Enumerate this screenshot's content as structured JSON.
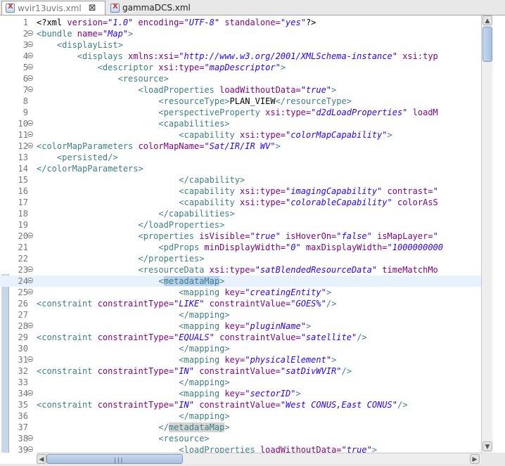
{
  "tabs": [
    {
      "title": "wvir13uvis.xml",
      "close": "⊠",
      "active": true
    },
    {
      "title": "gammaDCS.xml",
      "active": false
    }
  ],
  "lines": [
    {
      "n": "1",
      "fold": false,
      "segs": [
        [
          "t",
          "<?xml "
        ],
        [
          "a",
          "version="
        ],
        [
          "v",
          "\"1.0\""
        ],
        [
          "a",
          " encoding="
        ],
        [
          "v",
          "\"UTF-8\""
        ],
        [
          "a",
          " standalone="
        ],
        [
          "v",
          "\"yes\""
        ],
        [
          "t",
          "?>"
        ]
      ]
    },
    {
      "n": "2",
      "fold": true,
      "segs": [
        [
          "g",
          "<bundle "
        ],
        [
          "a",
          "name="
        ],
        [
          "v",
          "\"Map\""
        ],
        [
          "g",
          ">"
        ]
      ]
    },
    {
      "n": "3",
      "fold": true,
      "segs": [
        [
          "t",
          "    "
        ],
        [
          "g",
          "<displayList>"
        ]
      ]
    },
    {
      "n": "4",
      "fold": true,
      "segs": [
        [
          "t",
          "        "
        ],
        [
          "g",
          "<displays "
        ],
        [
          "a",
          "xmlns:xsi="
        ],
        [
          "v",
          "\"http://www.w3.org/2001/XMLSchema-instance\""
        ],
        [
          "a",
          " xsi:typ"
        ]
      ]
    },
    {
      "n": "5",
      "fold": true,
      "segs": [
        [
          "t",
          "            "
        ],
        [
          "g",
          "<descriptor "
        ],
        [
          "a",
          "xsi:type="
        ],
        [
          "v",
          "\"mapDescriptor\""
        ],
        [
          "g",
          ">"
        ]
      ]
    },
    {
      "n": "6",
      "fold": true,
      "segs": [
        [
          "t",
          "                "
        ],
        [
          "g",
          "<resource>"
        ]
      ]
    },
    {
      "n": "7",
      "fold": true,
      "segs": [
        [
          "t",
          "                    "
        ],
        [
          "g",
          "<loadProperties "
        ],
        [
          "a",
          "loadWithoutData="
        ],
        [
          "v",
          "\"true\""
        ],
        [
          "g",
          ">"
        ]
      ]
    },
    {
      "n": "8",
      "fold": false,
      "segs": [
        [
          "t",
          "                        "
        ],
        [
          "g",
          "<resourceType>"
        ],
        [
          "t",
          "PLAN_VIEW"
        ],
        [
          "g",
          "</resourceType>"
        ]
      ]
    },
    {
      "n": "9",
      "fold": false,
      "segs": [
        [
          "t",
          "                        "
        ],
        [
          "g",
          "<perspectiveProperty "
        ],
        [
          "a",
          "xsi:type="
        ],
        [
          "v",
          "\"d2dLoadProperties\""
        ],
        [
          "a",
          " loadM"
        ]
      ]
    },
    {
      "n": "10",
      "fold": true,
      "segs": [
        [
          "t",
          "                        "
        ],
        [
          "g",
          "<capabilities>"
        ]
      ]
    },
    {
      "n": "11",
      "fold": true,
      "segs": [
        [
          "t",
          "                            "
        ],
        [
          "g",
          "<capability "
        ],
        [
          "a",
          "xsi:type="
        ],
        [
          "v",
          "\"colorMapCapability\""
        ],
        [
          "g",
          ">"
        ]
      ]
    },
    {
      "n": "12",
      "fold": true,
      "segs": [
        [
          "g",
          "<colorMapParameters "
        ],
        [
          "a",
          "colorMapName="
        ],
        [
          "v",
          "\"Sat/IR/IR WV\""
        ],
        [
          "g",
          ">"
        ]
      ]
    },
    {
      "n": "13",
      "fold": false,
      "segs": [
        [
          "t",
          "    "
        ],
        [
          "g",
          "<persisted/>"
        ]
      ]
    },
    {
      "n": "14",
      "fold": false,
      "segs": [
        [
          "g",
          "</colorMapParameters>"
        ]
      ]
    },
    {
      "n": "15",
      "fold": false,
      "segs": [
        [
          "t",
          "                            "
        ],
        [
          "g",
          "</capability>"
        ]
      ]
    },
    {
      "n": "16",
      "fold": false,
      "segs": [
        [
          "t",
          "                            "
        ],
        [
          "g",
          "<capability "
        ],
        [
          "a",
          "xsi:type="
        ],
        [
          "v",
          "\"imagingCapability\""
        ],
        [
          "a",
          " contrast="
        ],
        [
          "v",
          "\""
        ]
      ]
    },
    {
      "n": "17",
      "fold": false,
      "segs": [
        [
          "t",
          "                            "
        ],
        [
          "g",
          "<capability "
        ],
        [
          "a",
          "xsi:type="
        ],
        [
          "v",
          "\"colorableCapability\""
        ],
        [
          "a",
          " colorAsS"
        ]
      ]
    },
    {
      "n": "18",
      "fold": false,
      "segs": [
        [
          "t",
          "                        "
        ],
        [
          "g",
          "</capabilities>"
        ]
      ]
    },
    {
      "n": "19",
      "fold": false,
      "segs": [
        [
          "t",
          "                    "
        ],
        [
          "g",
          "</loadProperties>"
        ]
      ]
    },
    {
      "n": "20",
      "fold": true,
      "segs": [
        [
          "t",
          "                    "
        ],
        [
          "g",
          "<properties "
        ],
        [
          "a",
          "isVisible="
        ],
        [
          "v",
          "\"true\""
        ],
        [
          "a",
          " isHoverOn="
        ],
        [
          "v",
          "\"false\""
        ],
        [
          "a",
          " isMapLayer="
        ],
        [
          "v",
          "\""
        ]
      ]
    },
    {
      "n": "21",
      "fold": false,
      "segs": [
        [
          "t",
          "                        "
        ],
        [
          "g",
          "<pdProps "
        ],
        [
          "a",
          "minDisplayWidth="
        ],
        [
          "v",
          "\"0\""
        ],
        [
          "a",
          " maxDisplayWidth="
        ],
        [
          "v",
          "\"1000000000"
        ]
      ]
    },
    {
      "n": "22",
      "fold": false,
      "segs": [
        [
          "t",
          "                    "
        ],
        [
          "g",
          "</properties>"
        ]
      ]
    },
    {
      "n": "23",
      "fold": true,
      "segs": [
        [
          "t",
          "                    "
        ],
        [
          "g",
          "<resourceData "
        ],
        [
          "a",
          "xsi:type="
        ],
        [
          "v",
          "\"satBlendedResourceData\""
        ],
        [
          "a",
          " timeMatchMo"
        ]
      ]
    },
    {
      "n": "24",
      "fold": true,
      "current": true,
      "segs": [
        [
          "t",
          "                        "
        ],
        [
          "g",
          "<"
        ],
        [
          "h",
          "metadataMap"
        ],
        [
          "g",
          ">"
        ]
      ]
    },
    {
      "n": "25",
      "fold": true,
      "segs": [
        [
          "t",
          "                            "
        ],
        [
          "g",
          "<mapping "
        ],
        [
          "a",
          "key="
        ],
        [
          "v",
          "\"creatingEntity\""
        ],
        [
          "g",
          ">"
        ]
      ]
    },
    {
      "n": "26",
      "fold": false,
      "segs": [
        [
          "g",
          "<constraint "
        ],
        [
          "a",
          "constraintType="
        ],
        [
          "v",
          "\"LIKE\""
        ],
        [
          "a",
          " constraintValue="
        ],
        [
          "v",
          "\"GOES%\""
        ],
        [
          "g",
          "/>"
        ]
      ]
    },
    {
      "n": "27",
      "fold": false,
      "segs": [
        [
          "t",
          "                            "
        ],
        [
          "g",
          "</mapping>"
        ]
      ]
    },
    {
      "n": "28",
      "fold": true,
      "segs": [
        [
          "t",
          "                            "
        ],
        [
          "g",
          "<mapping "
        ],
        [
          "a",
          "key="
        ],
        [
          "v",
          "\"pluginName\""
        ],
        [
          "g",
          ">"
        ]
      ]
    },
    {
      "n": "29",
      "fold": false,
      "segs": [
        [
          "g",
          "<constraint "
        ],
        [
          "a",
          "constraintType="
        ],
        [
          "v",
          "\"EQUALS\""
        ],
        [
          "a",
          " constraintValue="
        ],
        [
          "v",
          "\"satellite\""
        ],
        [
          "g",
          "/>"
        ]
      ]
    },
    {
      "n": "30",
      "fold": false,
      "segs": [
        [
          "t",
          "                            "
        ],
        [
          "g",
          "</mapping>"
        ]
      ]
    },
    {
      "n": "31",
      "fold": true,
      "segs": [
        [
          "t",
          "                            "
        ],
        [
          "g",
          "<mapping "
        ],
        [
          "a",
          "key="
        ],
        [
          "v",
          "\"physicalElement\""
        ],
        [
          "g",
          ">"
        ]
      ]
    },
    {
      "n": "32",
      "fold": false,
      "segs": [
        [
          "g",
          "<constraint "
        ],
        [
          "a",
          "constraintType="
        ],
        [
          "v",
          "\"IN\""
        ],
        [
          "a",
          " constraintValue="
        ],
        [
          "v",
          "\"satDivWVIR\""
        ],
        [
          "g",
          "/>"
        ]
      ]
    },
    {
      "n": "33",
      "fold": false,
      "segs": [
        [
          "t",
          "                            "
        ],
        [
          "g",
          "</mapping>"
        ]
      ]
    },
    {
      "n": "34",
      "fold": true,
      "segs": [
        [
          "t",
          "                            "
        ],
        [
          "g",
          "<mapping "
        ],
        [
          "a",
          "key="
        ],
        [
          "v",
          "\"sectorID\""
        ],
        [
          "g",
          ">"
        ]
      ]
    },
    {
      "n": "35",
      "fold": false,
      "segs": [
        [
          "g",
          "<constraint "
        ],
        [
          "a",
          "constraintType="
        ],
        [
          "v",
          "\"IN\""
        ],
        [
          "a",
          " constraintValue="
        ],
        [
          "v",
          "\"West CONUS,East CONUS\""
        ],
        [
          "g",
          "/>"
        ]
      ]
    },
    {
      "n": "36",
      "fold": false,
      "segs": [
        [
          "t",
          "                            "
        ],
        [
          "g",
          "</mapping>"
        ]
      ]
    },
    {
      "n": "37",
      "fold": false,
      "segs": [
        [
          "t",
          "                        "
        ],
        [
          "g",
          "</"
        ],
        [
          "h2",
          "metadataMap"
        ],
        [
          "g",
          ">"
        ]
      ]
    },
    {
      "n": "38",
      "fold": true,
      "segs": [
        [
          "t",
          "                        "
        ],
        [
          "g",
          "<resource>"
        ]
      ]
    },
    {
      "n": "39",
      "fold": true,
      "segs": [
        [
          "t",
          "                            "
        ],
        [
          "g",
          "<loadProperties "
        ],
        [
          "a",
          "loadWithoutData="
        ],
        [
          "v",
          "\"true\""
        ],
        [
          "g",
          ">"
        ]
      ]
    }
  ],
  "scrollbars": {
    "up": "▲",
    "down": "▼",
    "left": "◀",
    "right": "▶",
    "grip": "|||"
  }
}
